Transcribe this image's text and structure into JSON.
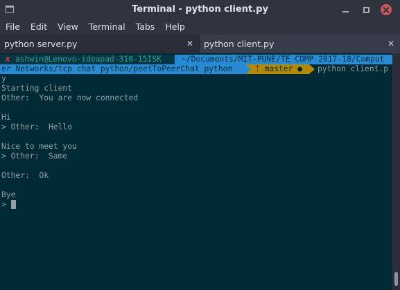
{
  "window": {
    "title": "Terminal - python client.py"
  },
  "menu": [
    "File",
    "Edit",
    "View",
    "Terminal",
    "Tabs",
    "Help"
  ],
  "tabs": [
    {
      "label": "python server.py",
      "active": false
    },
    {
      "label": "python client.py",
      "active": true
    }
  ],
  "prompt": {
    "status_mark": "✘",
    "user_host": "ashwin@Lenovo-ideapad-310-15ISK",
    "path_line1": "~/Documents/MIT-PUNE/TE COMP 2017-18/Comput",
    "path_line2": "er Networks/tcp chat python/peetToPeerChat python",
    "git_branch": "master ●",
    "git_branch_icon": "branch-icon",
    "command": "python client.p",
    "command_wrap": "y"
  },
  "output": [
    "Starting client",
    "Other:  You are now connected",
    "",
    "Hi",
    "> Other:  Hello",
    "",
    "Nice to meet you",
    "> Other:  Same",
    "",
    "Other:  Ok",
    "",
    "Bye",
    "> "
  ],
  "colors": {
    "terminal_bg": "#002b36",
    "terminal_fg": "#93a1a1",
    "prompt_dir": "#268bd2",
    "prompt_git": "#b58900",
    "prompt_error": "#dc322f"
  }
}
